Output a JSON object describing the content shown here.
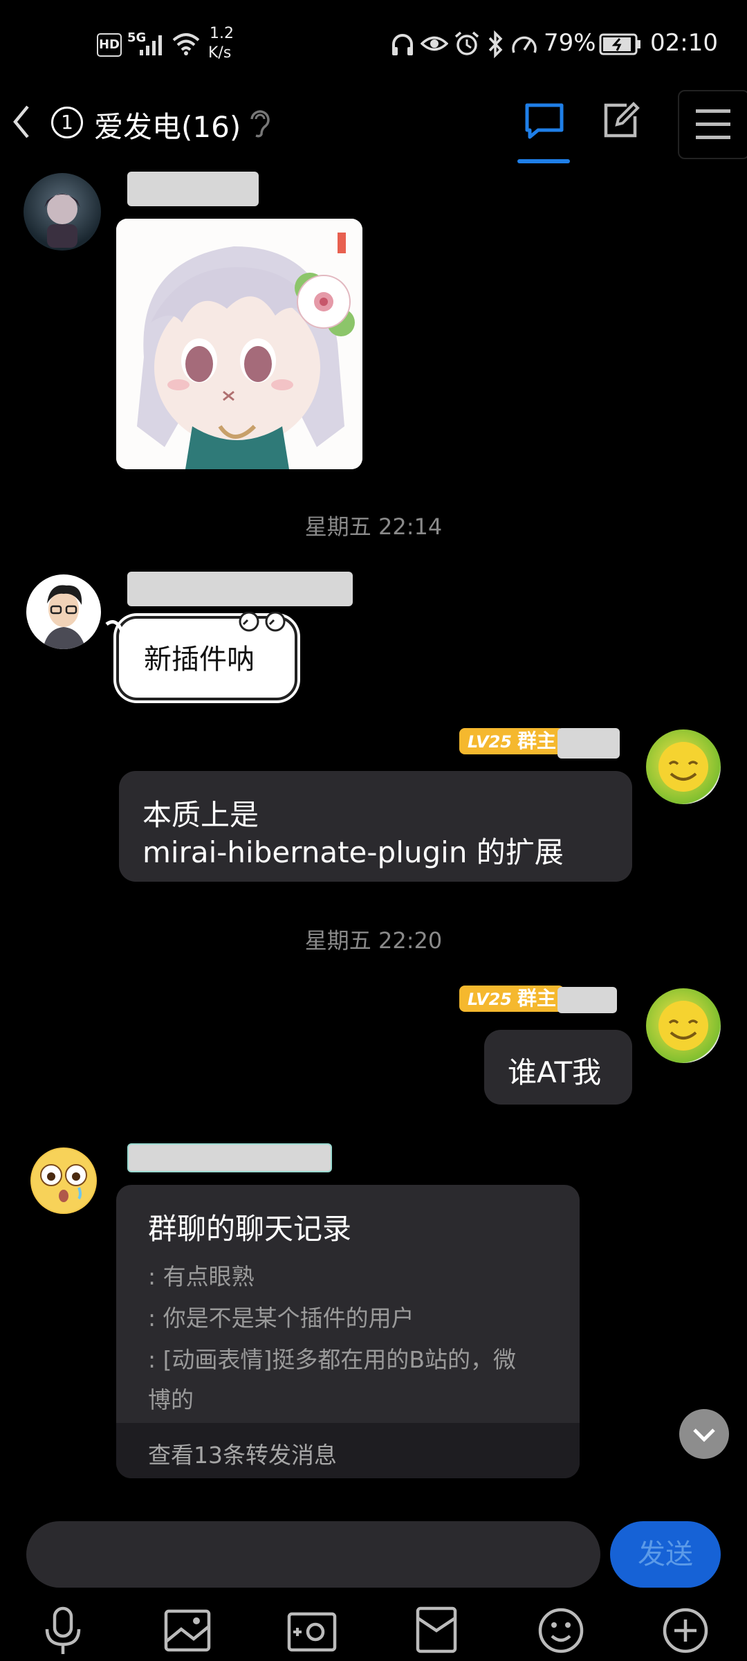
{
  "status_bar": {
    "hd": "HD",
    "network": "5G",
    "speed_value": "1.2",
    "speed_unit": "K/s",
    "battery": "79%",
    "time": "02:10"
  },
  "header": {
    "unread": "1",
    "title": "爱发电(16)"
  },
  "messages": {
    "time1": "星期五 22:14",
    "msg2_text": "新插件呐",
    "badge_level": "LV25",
    "badge_role": "群主",
    "msg3_line1": "本质上是",
    "msg3_line2": "mirai-hibernate-plugin 的扩展",
    "time2": "星期五 22:20",
    "msg4_text": "谁AT我",
    "forward": {
      "title": "群聊的聊天记录",
      "line1": ": 有点眼熟",
      "line2": ": 你是不是某个插件的用户",
      "line3a": ": [动画表情]挺多都在用的B站的，微",
      "line3b": "博的",
      "footer": "查看13条转发消息"
    }
  },
  "composer": {
    "send_label": "发送"
  },
  "colors": {
    "accent": "#1f7fe8",
    "badge": "#f5b82e",
    "bubble": "#2b2a2e"
  }
}
